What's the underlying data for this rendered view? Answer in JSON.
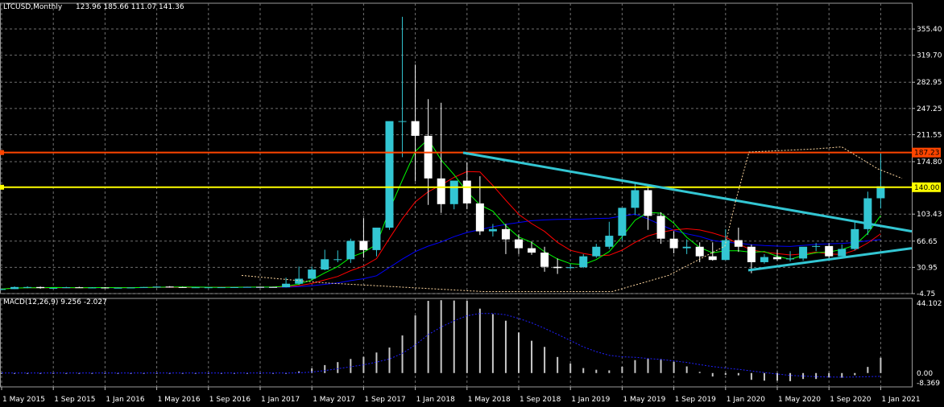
{
  "header": {
    "symbol_label": "LTCUSD,Monthly",
    "ohlc_label": "123.96 185.66 111.07 141.36"
  },
  "macd": {
    "label": "MACD(12,26,9) 9.256 -2.027",
    "axis_labels": [
      "44.102",
      "0.00",
      "-8.369"
    ]
  },
  "price_axis": {
    "labels": [
      "355.40",
      "319.70",
      "282.95",
      "247.25",
      "211.55",
      "174.80",
      "103.43",
      "66.65",
      "30.95",
      "-4.75"
    ]
  },
  "price_markers": [
    {
      "label": "187.23",
      "color": "#ff4500"
    },
    {
      "label": "140.00",
      "color": "#ffff00"
    }
  ],
  "time_axis": {
    "labels": [
      "1 May 2015",
      "1 Sep 2015",
      "1 Jan 2016",
      "1 May 2016",
      "1 Sep 2016",
      "1 Jan 2017",
      "1 May 2017",
      "1 Sep 2017",
      "1 Jan 2018",
      "1 May 2018",
      "1 Sep 2018",
      "1 Jan 2019",
      "1 May 2019",
      "1 Sep 2019",
      "1 Jan 2020",
      "1 May 2020",
      "1 Sep 2020",
      "1 Jan 2021"
    ]
  },
  "colors": {
    "background": "#000000",
    "grid": "#6f6f6f",
    "bull_candle": "#33c6d3",
    "bear_candle": "#ffffff",
    "trendline": "#33c6d3",
    "hline_red": "#ff4500",
    "hline_yellow": "#ffff00",
    "ma_fast": "#00ff00",
    "ma_mid": "#ff0000",
    "ma_slow": "#0000ff",
    "envelope": "#ffd7a0"
  },
  "chart_data": [
    {
      "type": "candlestick",
      "title": "LTCUSD,Monthly",
      "ylim": [
        -4.75,
        373
      ],
      "grid": true,
      "x": [
        "2015-05",
        "2015-06",
        "2015-07",
        "2015-08",
        "2015-09",
        "2015-10",
        "2015-11",
        "2015-12",
        "2016-01",
        "2016-02",
        "2016-03",
        "2016-04",
        "2016-05",
        "2016-06",
        "2016-07",
        "2016-08",
        "2016-09",
        "2016-10",
        "2016-11",
        "2016-12",
        "2017-01",
        "2017-02",
        "2017-03",
        "2017-04",
        "2017-05",
        "2017-06",
        "2017-07",
        "2017-08",
        "2017-09",
        "2017-10",
        "2017-11",
        "2017-12",
        "2018-01",
        "2018-02",
        "2018-03",
        "2018-04",
        "2018-05",
        "2018-06",
        "2018-07",
        "2018-08",
        "2018-09",
        "2018-10",
        "2018-11",
        "2018-12",
        "2019-01",
        "2019-02",
        "2019-03",
        "2019-04",
        "2019-05",
        "2019-06",
        "2019-07",
        "2019-08",
        "2019-09",
        "2019-10",
        "2019-11",
        "2019-12",
        "2020-01",
        "2020-02",
        "2020-03",
        "2020-04",
        "2020-05",
        "2020-06",
        "2020-07",
        "2020-08",
        "2020-09",
        "2020-10",
        "2020-11",
        "2020-12",
        "2021-01"
      ],
      "open": [
        1.4,
        1.4,
        4.2,
        4.2,
        2.8,
        3.0,
        3.8,
        3.4,
        3.5,
        3.2,
        3.2,
        3.5,
        4.2,
        4.8,
        4.1,
        3.8,
        3.8,
        3.8,
        3.9,
        4.0,
        4.4,
        4.3,
        3.9,
        8.7,
        15.5,
        28.0,
        42.0,
        42.0,
        67.0,
        54.5,
        85.0,
        230.0,
        230.0,
        210.0,
        152.0,
        117.0,
        149.0,
        118.0,
        80.0,
        83.0,
        69.0,
        57.0,
        51.0,
        31.7,
        30.0,
        31.2,
        46.0,
        59.0,
        74.0,
        112.0,
        136.0,
        101.0,
        70.0,
        57.0,
        59.0,
        46.0,
        41.0,
        68.0,
        59.0,
        38.0,
        45.0,
        42.0,
        43.0,
        59.0,
        60.0,
        46.0,
        56.0,
        83.0,
        125.0
      ],
      "high": [
        1.8,
        5.0,
        5.2,
        4.8,
        3.2,
        4.5,
        4.6,
        4.0,
        4.0,
        3.5,
        3.6,
        4.3,
        5.2,
        5.4,
        4.6,
        4.2,
        4.2,
        4.2,
        4.3,
        4.6,
        4.7,
        4.5,
        17.0,
        32.0,
        32.0,
        55.0,
        54.0,
        70.0,
        98.0,
        68.0,
        99.0,
        372.0,
        307.0,
        260.0,
        255.0,
        147.0,
        174.0,
        155.0,
        90.0,
        90.0,
        76.0,
        66.0,
        59.0,
        43.0,
        35.0,
        49.0,
        63.0,
        93.0,
        110.0,
        145.0,
        144.0,
        106.0,
        80.0,
        69.0,
        65.0,
        65.0,
        83.0,
        85.0,
        62.0,
        49.0,
        55.0,
        53.0,
        53.0,
        64.0,
        64.0,
        62.0,
        93.0,
        134.0,
        185.66
      ],
      "low": [
        1.2,
        1.3,
        2.5,
        2.0,
        2.6,
        2.8,
        3.0,
        3.1,
        3.0,
        2.9,
        2.9,
        3.3,
        3.9,
        3.6,
        3.5,
        3.5,
        3.6,
        3.7,
        3.8,
        3.9,
        3.9,
        3.7,
        3.6,
        7.0,
        14.0,
        27.0,
        38.0,
        37.0,
        44.0,
        46.0,
        82.0,
        181.0,
        148.0,
        116.0,
        105.0,
        110.0,
        110.0,
        75.0,
        73.0,
        49.0,
        49.0,
        48.0,
        25.0,
        22.0,
        29.0,
        30.0,
        44.0,
        56.0,
        67.0,
        102.0,
        82.0,
        63.0,
        50.0,
        49.0,
        38.0,
        40.0,
        41.0,
        52.0,
        23.0,
        36.0,
        40.0,
        39.0,
        40.0,
        53.0,
        42.0,
        46.0,
        54.0,
        75.0,
        111.07
      ],
      "close": [
        1.4,
        4.2,
        4.2,
        2.8,
        3.0,
        3.8,
        3.4,
        3.5,
        3.2,
        3.2,
        3.5,
        4.2,
        4.8,
        4.1,
        3.8,
        3.8,
        3.8,
        3.9,
        4.0,
        4.4,
        4.3,
        3.9,
        8.7,
        15.5,
        28.0,
        42.0,
        42.0,
        67.0,
        54.5,
        85.0,
        230.0,
        230.0,
        210.0,
        152.0,
        117.0,
        149.0,
        118.0,
        80.0,
        83.0,
        69.0,
        57.0,
        51.0,
        31.7,
        30.0,
        31.2,
        46.0,
        59.0,
        74.0,
        112.0,
        136.0,
        101.0,
        70.0,
        57.0,
        59.0,
        46.0,
        41.0,
        68.0,
        59.0,
        38.0,
        45.0,
        42.0,
        43.0,
        59.0,
        60.0,
        46.0,
        56.0,
        83.0,
        125.0,
        141.36
      ]
    },
    {
      "type": "bar",
      "title": "MACD(12,26,9) 9.256 -2.027",
      "ylim": [
        -8.369,
        44.102
      ],
      "macd": [
        0,
        0,
        0,
        0,
        0,
        0,
        0,
        0,
        0,
        0,
        0,
        0,
        0,
        0,
        0,
        0,
        0,
        0,
        0,
        0,
        0,
        0,
        0,
        1.0,
        2.8,
        4.8,
        6.6,
        8.5,
        9.8,
        12.4,
        15.4,
        22.7,
        34.8,
        43.6,
        44.0,
        43.8,
        43.6,
        38.9,
        35.6,
        31.6,
        24.5,
        19.5,
        15.8,
        9.7,
        5.7,
        3.0,
        2.0,
        1.6,
        3.8,
        7.8,
        8.8,
        8.5,
        6.8,
        4.0,
        0.7,
        -2.1,
        -1.1,
        -1.4,
        -4.1,
        -4.6,
        -4.6,
        -4.9,
        -3.6,
        -3.6,
        -2.6,
        -2.8,
        -1.3,
        3.7,
        9.256
      ],
      "signal": [
        0,
        0,
        0,
        0,
        0,
        0,
        0,
        0,
        0,
        0,
        0,
        0,
        0,
        0,
        0,
        0,
        0,
        0,
        0,
        0,
        0,
        0,
        0,
        0.1,
        0.6,
        1.5,
        2.6,
        3.8,
        5.0,
        6.6,
        8.5,
        11.9,
        17.0,
        23.2,
        27.8,
        31.6,
        34.6,
        36.0,
        36.0,
        35.2,
        33.0,
        30.3,
        27.0,
        23.4,
        19.6,
        15.8,
        12.9,
        10.7,
        9.8,
        9.5,
        8.8,
        8.2,
        7.3,
        6.4,
        5.1,
        3.9,
        3.0,
        2.2,
        1.3,
        0.3,
        -0.6,
        -1.4,
        -1.8,
        -2.2,
        -2.4,
        -2.5,
        -2.4,
        -2.2,
        -2.027
      ]
    }
  ]
}
